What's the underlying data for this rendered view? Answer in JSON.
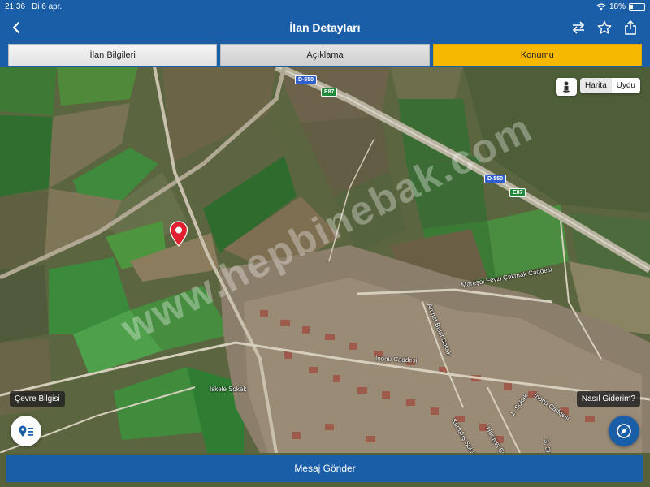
{
  "status_bar": {
    "time": "21:36",
    "date": "Di 6 apr.",
    "battery": "18%",
    "battery_level": 0.18
  },
  "header": {
    "title": "İlan Detayları"
  },
  "tabs": [
    {
      "label": "İlan Bilgileri",
      "active": false
    },
    {
      "label": "Açıklama",
      "active": false
    },
    {
      "label": "Konumu",
      "active": true
    }
  ],
  "map": {
    "type_options": [
      "Harita",
      "Uydu"
    ],
    "selected_type": "Harita",
    "watermark": "www.hepbinebak.com",
    "road_shields": {
      "d550": "D-550",
      "e87": "E87"
    },
    "streets": {
      "maresal": "Mareşal Fevzi Çakmak Caddesi",
      "ahmet": "Ahmet Balat Sokak",
      "inonu": "İnönü Caddesi",
      "inonu2": "İnönü Caddesi",
      "iskele": "İskele Sokak",
      "kurtul": "Kurtuluş Sokak",
      "hurriyet": "Hürriyet Sokak",
      "s1": "1. Sokak",
      "s3": "3. Sk"
    },
    "env_info_label": "Çevre Bilgisi",
    "directions_label": "Nasıl Giderim?"
  },
  "actions": {
    "send_message": "Mesaj Gönder"
  },
  "colors": {
    "primary": "#1b5ea8",
    "active_tab": "#f7b800",
    "pin": "#e0202e"
  }
}
